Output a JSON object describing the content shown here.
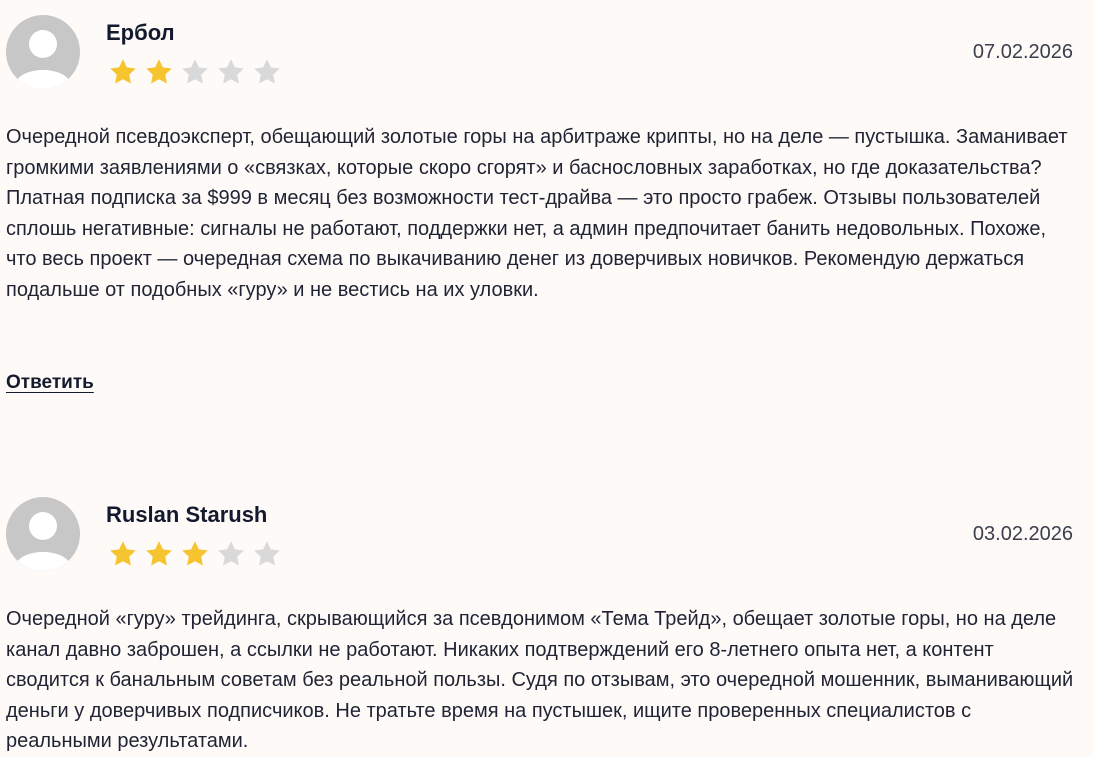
{
  "reviews": [
    {
      "author": "Ербол",
      "date": "07.02.2026",
      "rating": 2,
      "max_rating": 5,
      "text": "Очередной псевдоэксперт, обещающий золотые горы на арбитраже крипты, но на деле — пустышка. Заманивает громкими заявлениями о «связках, которые скоро сгорят» и баснословных заработках, но где доказательства? Платная подписка за $999 в месяц без возможности тест-драйва — это просто грабеж. Отзывы пользователей сплошь негативные: сигналы не работают, поддержки нет, а админ предпочитает банить недовольных. Похоже, что весь проект — очередная схема по выкачиванию денег из доверчивых новичков. Рекомендую держаться подальше от подобных «гуру» и не вестись на их уловки.",
      "reply_label": "Ответить"
    },
    {
      "author": "Ruslan Starush",
      "date": "03.02.2026",
      "rating": 3,
      "max_rating": 5,
      "text": "Очередной «гуру» трейдинга, скрывающийся за псевдонимом «Тема Трейд», обещает золотые горы, но на деле канал давно заброшен, а ссылки не работают. Никаких подтверждений его 8-летнего опыта нет, а контент сводится к банальным советам без реальной пользы. Судя по отзывам, это очередной мошенник, выманивающий деньги у доверчивых подписчиков. Не тратьте время на пустышек, ищите проверенных специалистов с реальными результатами."
    }
  ],
  "colors": {
    "star_filled": "#f6c42f",
    "star_empty": "#d9d9d9",
    "avatar_bg": "#c7c7c7",
    "avatar_fg": "#ffffff"
  },
  "icons": {
    "avatar": "user-avatar-icon",
    "star": "star-icon"
  }
}
